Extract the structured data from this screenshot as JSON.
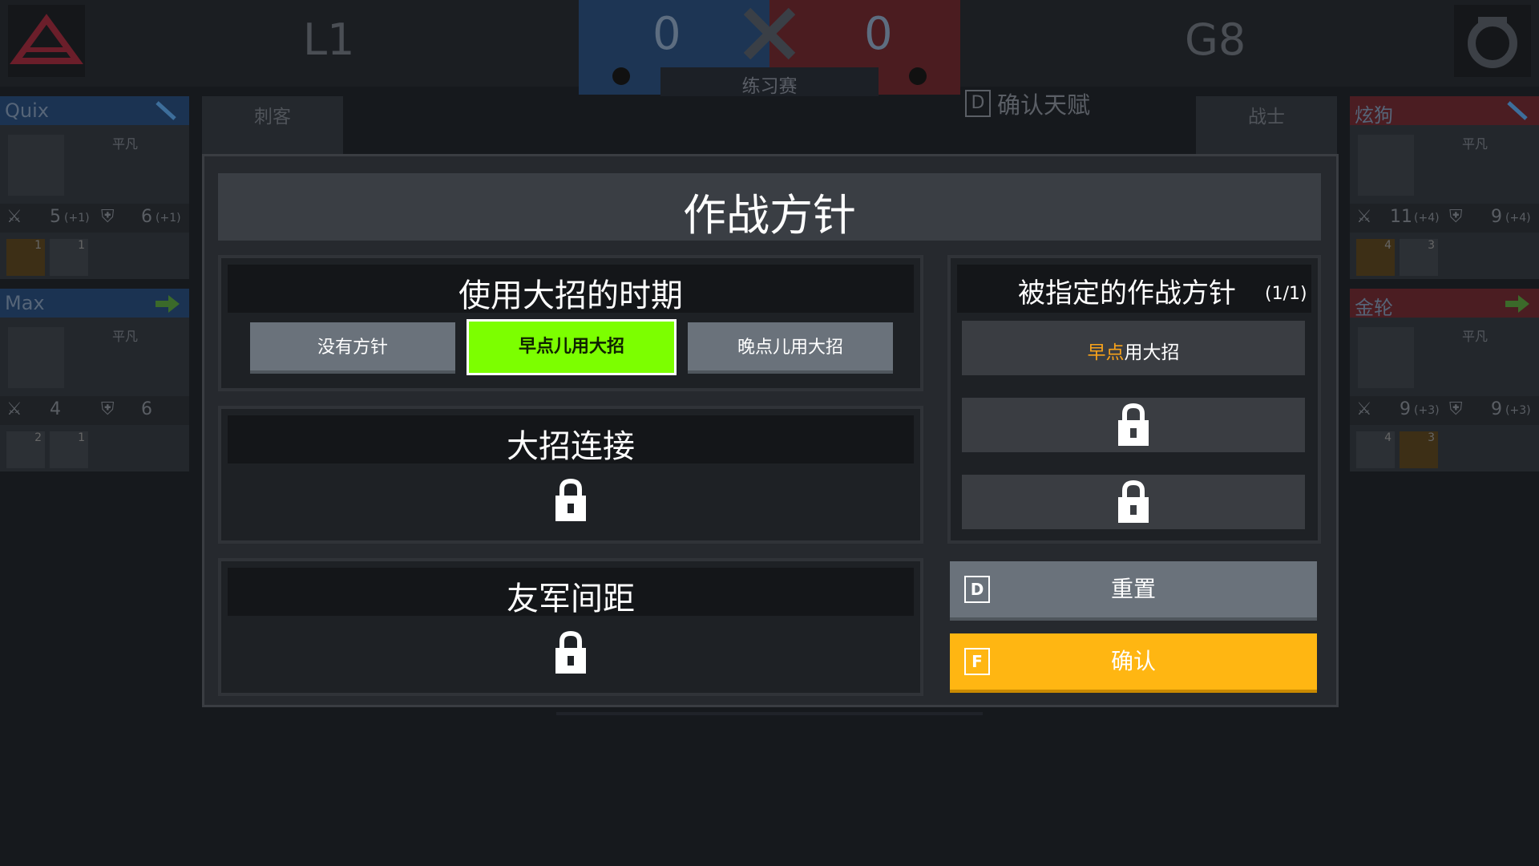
{
  "top": {
    "left_team": "L1",
    "right_team": "G8",
    "score_blue": "0",
    "score_red": "0",
    "mode": "练习赛",
    "confirm_talent_key": "D",
    "confirm_talent_label": "确认天赋",
    "role_left": "刺客",
    "role_right": "战士"
  },
  "players_left": [
    {
      "name": "Quix",
      "tier": "平凡",
      "atk": "5",
      "atk_bonus": "(+1)",
      "def": "6",
      "def_bonus": "(+1)",
      "mini": [
        "1",
        "1"
      ]
    },
    {
      "name": "Max",
      "tier": "平凡",
      "atk": "4",
      "atk_bonus": "",
      "def": "6",
      "def_bonus": "",
      "mini": [
        "2",
        "1"
      ]
    }
  ],
  "players_right": [
    {
      "name": "炫狗",
      "tier": "平凡",
      "atk": "11",
      "atk_bonus": "(+4)",
      "def": "9",
      "def_bonus": "(+4)",
      "mini": [
        "4",
        "3"
      ]
    },
    {
      "name": "金轮",
      "tier": "平凡",
      "atk": "9",
      "atk_bonus": "(+3)",
      "def": "9",
      "def_bonus": "(+3)",
      "mini": [
        "4",
        "3"
      ]
    }
  ],
  "modal": {
    "title": "作战方针",
    "section_timing": {
      "title": "使用大招的时期",
      "options": [
        "没有方针",
        "早点儿用大招",
        "晚点儿用大招"
      ],
      "selected_index": 1
    },
    "section_chain": {
      "title": "大招连接",
      "locked": true
    },
    "section_spacing": {
      "title": "友军间距",
      "locked": true
    },
    "assigned": {
      "title": "被指定的作战方针",
      "count": "(1/1)",
      "slot1_highlight": "早点",
      "slot1_rest": "用大招",
      "slot2_locked": true,
      "slot3_locked": true
    },
    "reset": {
      "key": "D",
      "label": "重置"
    },
    "confirm": {
      "key": "F",
      "label": "确认"
    }
  },
  "colors": {
    "accent_green": "#7cff00",
    "confirm_yellow": "#ffb612",
    "reset_gray": "#6a727b",
    "highlight_orange": "#f7a21b"
  },
  "icons": [
    "lock-icon",
    "crossed-swords-icon",
    "sword-icon",
    "shield-icon",
    "arrow-icon"
  ]
}
